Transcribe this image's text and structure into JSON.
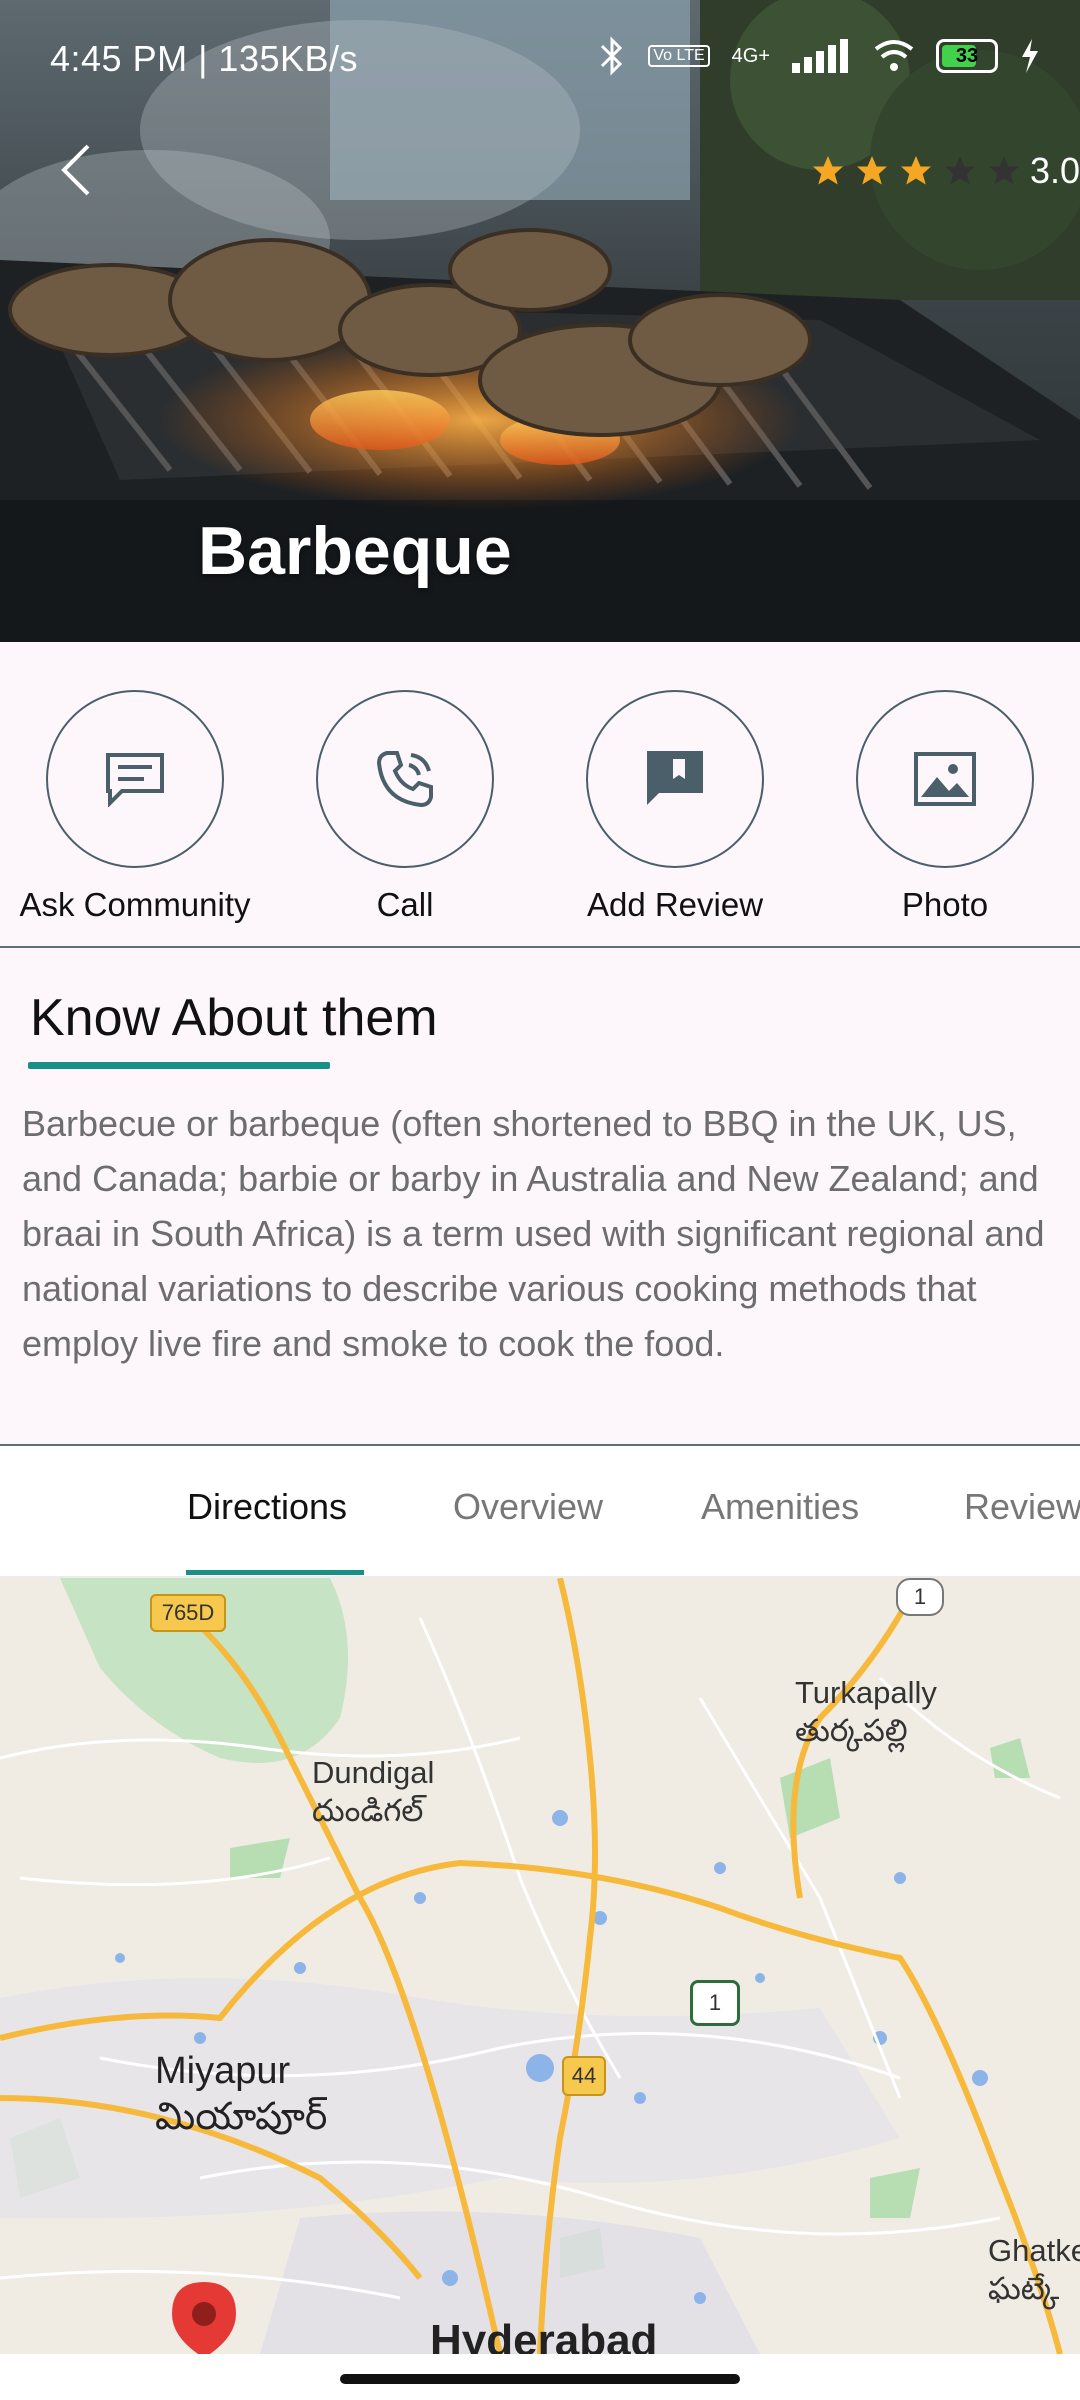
{
  "status_bar": {
    "time_speed": "4:45 PM | 135KB/s",
    "network": "4G+",
    "volte": "Vo LTE",
    "battery": "33"
  },
  "header": {
    "title": "Barbeque",
    "rating_value": "3.0",
    "rating_stars": 3,
    "rating_max": 5
  },
  "actions": [
    {
      "label": "Ask Community",
      "icon": "chat-icon"
    },
    {
      "label": "Call",
      "icon": "phone-icon"
    },
    {
      "label": "Add Review",
      "icon": "review-icon"
    },
    {
      "label": "Photo",
      "icon": "image-icon"
    }
  ],
  "about": {
    "title": "Know About them",
    "text": "Barbecue or barbeque (often shortened to BBQ in the UK, US, and Canada; barbie or barby in Australia and New Zealand; and braai in South Africa) is a term used with significant regional and national variations to describe various cooking methods that employ live fire and smoke to cook the food."
  },
  "tabs": {
    "active": "Directions",
    "items": [
      "Directions",
      "Overview",
      "Amenities",
      "Reviews"
    ]
  },
  "map": {
    "labels": {
      "turkapally_en": "Turkapally",
      "turkapally_te": "తుర్కపల్లి",
      "dundigal_en": "Dundigal",
      "dundigal_te": "దుండిగల్",
      "miyapur_en": "Miyapur",
      "miyapur_te": "మియాపూర్",
      "hyderabad": "Hyderabad",
      "ghatkesar_en": "Ghatke",
      "ghatkesar_te": "ఘట్కే"
    },
    "shields": {
      "road_765d": "765D",
      "road_1_top": "1",
      "road_1_mid": "1",
      "road_44": "44"
    }
  },
  "colors": {
    "accent": "#1a8f85",
    "star": "#f5a623",
    "text_muted": "#6d6d6d",
    "map_road": "#f6b93b"
  }
}
